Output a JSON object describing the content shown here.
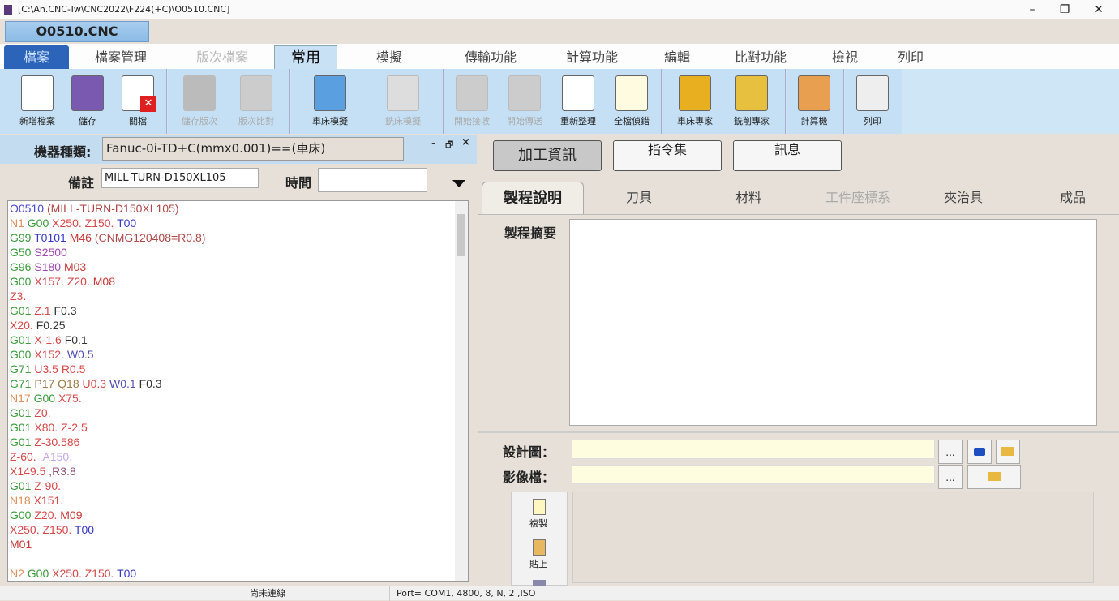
{
  "window": {
    "title": "[C:\\An.CNC-Tw\\CNC2022\\F224(+C)\\O0510.CNC]",
    "minimize": "–",
    "restore": "❐",
    "close": "✕"
  },
  "file_tab": "O0510.CNC",
  "ribbon_tabs": [
    {
      "label": "檔案"
    },
    {
      "label": "檔案管理"
    },
    {
      "label": "版次檔案"
    },
    {
      "label": "常用"
    },
    {
      "label": "模擬"
    },
    {
      "label": "傳輸功能"
    },
    {
      "label": "計算功能"
    },
    {
      "label": "編輯"
    },
    {
      "label": "比對功能"
    },
    {
      "label": "檢視"
    },
    {
      "label": "列印"
    }
  ],
  "toolbar": [
    {
      "label": "新增檔案",
      "icon": "new-file-icon"
    },
    {
      "label": "儲存",
      "icon": "save-icon"
    },
    {
      "label": "關檔",
      "icon": "close-file-icon"
    },
    {
      "label": "儲存版次",
      "icon": "save-version-icon"
    },
    {
      "label": "版次比對",
      "icon": "compare-version-icon"
    },
    {
      "label": "車床模擬",
      "icon": "lathe-sim-icon"
    },
    {
      "label": "銑床模擬",
      "icon": "mill-sim-icon"
    },
    {
      "label": "開始接收",
      "icon": "receive-icon"
    },
    {
      "label": "開始傳送",
      "icon": "send-icon"
    },
    {
      "label": "重新整理",
      "icon": "refresh-icon"
    },
    {
      "label": "全檔偵錯",
      "icon": "debug-icon"
    },
    {
      "label": "車床專家",
      "icon": "lathe-expert-icon"
    },
    {
      "label": "銑削專家",
      "icon": "mill-expert-icon"
    },
    {
      "label": "計算機",
      "icon": "calculator-icon"
    },
    {
      "label": "列印",
      "icon": "printer-icon"
    }
  ],
  "left": {
    "machine_label": "機器種類:",
    "machine_value": "Fanuc-0i-TD+C(mmx0.001)==(車床)",
    "note_label": "備註",
    "note_value": "MILL-TURN-D150XL105",
    "time_label": "時間",
    "time_value": "",
    "panel_min": "-",
    "panel_restore": "🗗",
    "panel_close": "×"
  },
  "code": [
    [
      [
        "O",
        "O0510 "
      ],
      [
        "c",
        "(MILL-TURN-D150XL105)"
      ]
    ],
    [
      [
        "N",
        "N1 "
      ],
      [
        "G",
        "G00 "
      ],
      [
        "X",
        "X250. Z150. "
      ],
      [
        "T",
        "T00"
      ]
    ],
    [
      [
        "G",
        "G99 "
      ],
      [
        "T",
        "T0101 "
      ],
      [
        "M",
        "M46 "
      ],
      [
        "c",
        "(CNMG120408=R0.8)"
      ]
    ],
    [
      [
        "G",
        "G50 "
      ],
      [
        "S",
        "S2500"
      ]
    ],
    [
      [
        "G",
        "G96 "
      ],
      [
        "S",
        "S180 "
      ],
      [
        "M",
        "M03"
      ]
    ],
    [
      [
        "G",
        "G00 "
      ],
      [
        "X",
        "X157. Z20. "
      ],
      [
        "M",
        "M08"
      ]
    ],
    [
      [
        "X",
        "Z3."
      ]
    ],
    [
      [
        "G",
        "G01 "
      ],
      [
        "X",
        "Z.1 "
      ],
      [
        "F",
        "F0.3"
      ]
    ],
    [
      [
        "X",
        "X20. "
      ],
      [
        "F",
        "F0.25"
      ]
    ],
    [
      [
        "G",
        "G01 "
      ],
      [
        "X",
        "X-1.6 "
      ],
      [
        "F",
        "F0.1"
      ]
    ],
    [
      [
        "G",
        "G00 "
      ],
      [
        "X",
        "X152. "
      ],
      [
        "W",
        "W0.5"
      ]
    ],
    [
      [
        "G",
        "G71 "
      ],
      [
        "X",
        "U3.5 R0.5"
      ]
    ],
    [
      [
        "G",
        "G71 "
      ],
      [
        "P",
        "P17 Q18 "
      ],
      [
        "X",
        "U0.3 "
      ],
      [
        "W",
        "W0.1 "
      ],
      [
        "F",
        "F0.3"
      ]
    ],
    [
      [
        "N",
        "N17 "
      ],
      [
        "G",
        "G00 "
      ],
      [
        "X",
        "X75."
      ]
    ],
    [
      [
        "G",
        "G01 "
      ],
      [
        "X",
        "Z0."
      ]
    ],
    [
      [
        "G",
        "G01 "
      ],
      [
        "X",
        "X80. Z-2.5"
      ]
    ],
    [
      [
        "G",
        "G01 "
      ],
      [
        "X",
        "Z-30.586"
      ]
    ],
    [
      [
        "X",
        "Z-60. "
      ],
      [
        "A",
        ",A150."
      ]
    ],
    [
      [
        "X",
        "X149.5 "
      ],
      [
        "R",
        ",R3.8"
      ]
    ],
    [
      [
        "G",
        "G01 "
      ],
      [
        "X",
        "Z-90."
      ]
    ],
    [
      [
        "N",
        "N18 "
      ],
      [
        "X",
        "X151."
      ]
    ],
    [
      [
        "G",
        "G00 "
      ],
      [
        "X",
        "Z20. "
      ],
      [
        "M",
        "M09"
      ]
    ],
    [
      [
        "X",
        "X250. Z150. "
      ],
      [
        "T",
        "T00"
      ]
    ],
    [
      [
        "M",
        "M01"
      ]
    ],
    [],
    [
      [
        "N",
        "N2 "
      ],
      [
        "G",
        "G00 "
      ],
      [
        "X",
        "X250. Z150. "
      ],
      [
        "T",
        "T00"
      ]
    ]
  ],
  "right": {
    "section_buttons": [
      "加工資訊",
      "指令集",
      "訊息"
    ],
    "tabs": [
      "製程說明",
      "刀具",
      "材料",
      "工件座標系",
      "夾治具",
      "成品"
    ],
    "summary_label": "製程摘要",
    "summary_value": "",
    "design_label": "設計圖：",
    "image_label": "影像檔：",
    "browse": "...",
    "copy_label": "複製",
    "paste_label": "貼上"
  },
  "status": {
    "connection": "尚未連線",
    "port": "Port= COM1, 4800, 8, N, 2 ,ISO"
  }
}
